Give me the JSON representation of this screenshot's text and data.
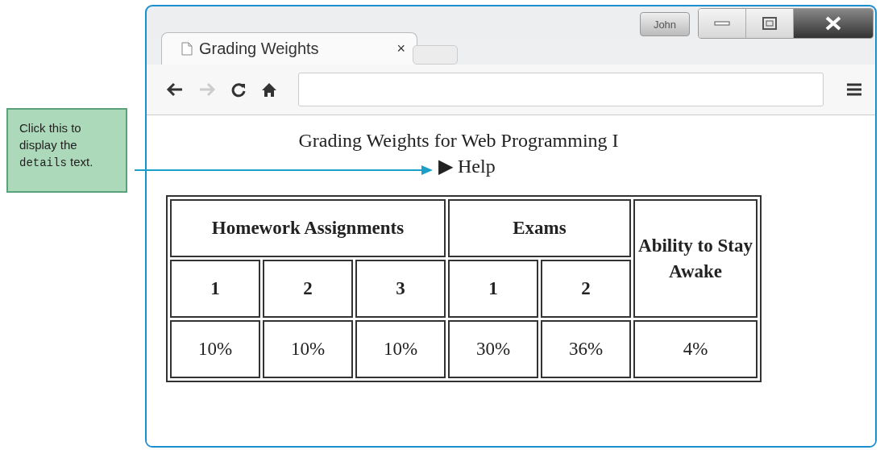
{
  "callout": {
    "text_before": "Click this to display the",
    "code": "details",
    "text_after": "text."
  },
  "window": {
    "user": "John"
  },
  "tabs": [
    {
      "title": "Grading Weights",
      "close": "×",
      "selected": true
    }
  ],
  "page": {
    "heading": "Grading Weights for Web Programming I",
    "summary": {
      "marker": "▶",
      "label": "Help"
    },
    "table": {
      "group_headers": [
        {
          "label": "Homework Assignments",
          "columns": [
            "1",
            "2",
            "3"
          ]
        },
        {
          "label": "Exams",
          "columns": [
            "1",
            "2"
          ]
        }
      ],
      "side_header": "Ability to Stay Awake",
      "rows": [
        [
          "10%",
          "10%",
          "10%",
          "30%",
          "36%",
          "4%"
        ]
      ]
    }
  }
}
